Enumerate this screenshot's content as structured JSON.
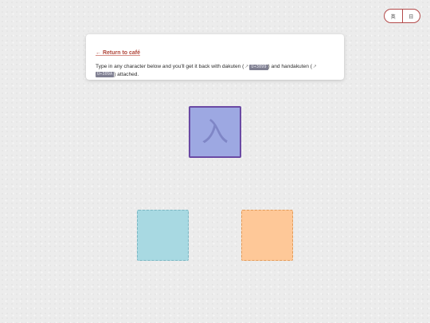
{
  "language_toggle": {
    "options": [
      {
        "label": "英"
      },
      {
        "label": "日"
      }
    ]
  },
  "card": {
    "back_link": "← Return to café",
    "text_before": "Type in any character below and you'll get it back with dakuten (",
    "dakuten_code": "U+3099",
    "text_middle": ") and handakuten (",
    "handakuten_code": "U+309A",
    "text_after": ") attached.",
    "external_icon": "↗"
  },
  "input": {
    "character": "入"
  },
  "outputs": {
    "dakuten_result": "",
    "handakuten_result": ""
  },
  "colors": {
    "input_tile": "#9da8e2",
    "input_border": "#6a49a4",
    "dakuten_tile": "#a8d9e2",
    "handakuten_tile": "#fec898",
    "link": "#b0483c"
  }
}
